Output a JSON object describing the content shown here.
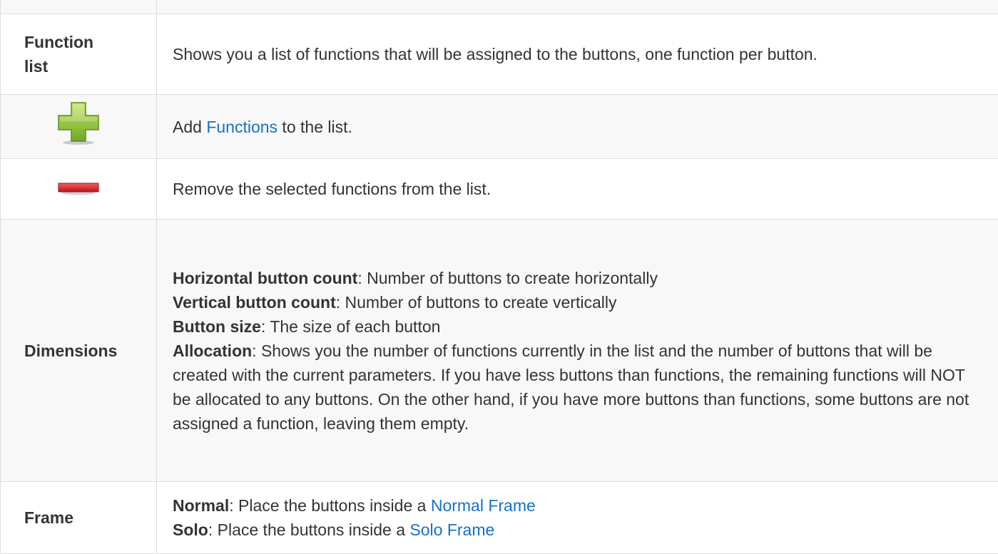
{
  "rows": {
    "function_list": {
      "label_line1": "Function",
      "label_line2": "list",
      "description": "Shows you a list of functions that will be assigned to the buttons, one function per button."
    },
    "add": {
      "icon": "plus-icon",
      "text_before": "Add ",
      "link": "Functions",
      "text_after": " to the list."
    },
    "remove": {
      "icon": "minus-icon",
      "text": "Remove the selected functions from the list."
    },
    "dimensions": {
      "label": "Dimensions",
      "items": [
        {
          "term": "Horizontal button count",
          "desc": ": Number of buttons to create horizontally"
        },
        {
          "term": "Vertical button count",
          "desc": ": Number of buttons to create vertically"
        },
        {
          "term": "Button size",
          "desc": ": The size of each button"
        },
        {
          "term": "Allocation",
          "desc": ": Shows you the number of functions currently in the list and the number of buttons that will be created with the current parameters. If you have less buttons than functions, the remaining functions will NOT be allocated to any buttons. On the other hand, if you have more buttons than functions, some buttons are not assigned a function, leaving them empty."
        }
      ]
    },
    "frame": {
      "label": "Frame",
      "items": [
        {
          "term": "Normal",
          "desc": ": Place the buttons inside a ",
          "link": "Normal Frame"
        },
        {
          "term": "Solo",
          "desc": ": Place the buttons inside a ",
          "link": "Solo Frame"
        }
      ]
    }
  },
  "colors": {
    "link": "#1670c9",
    "border": "#dddddd",
    "alt_row": "#f8f8f8",
    "plus_icon": "#8cc63f",
    "minus_icon": "#d9232d"
  }
}
